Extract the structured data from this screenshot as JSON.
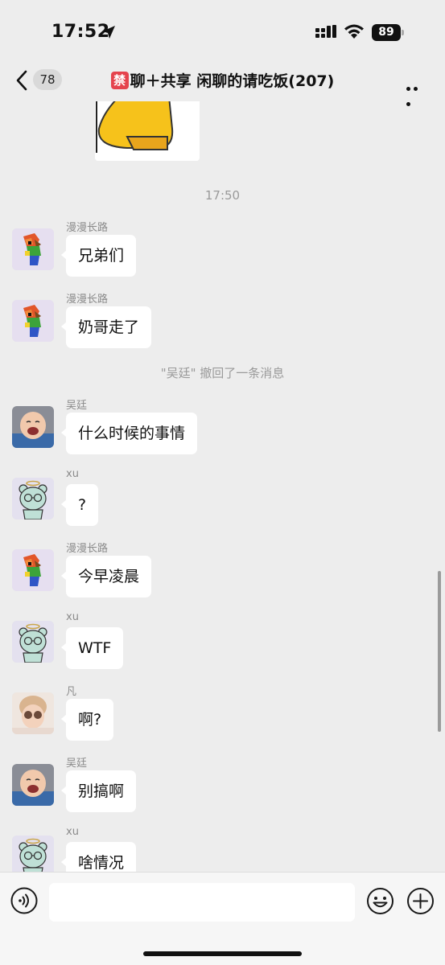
{
  "status_bar": {
    "time": "17:52",
    "battery": "89"
  },
  "nav": {
    "unread_count": "78",
    "title_badge": "禁",
    "title": "聊＋共享 闲聊的请吃饭(207)"
  },
  "chat": {
    "time_divider": "17:50",
    "system_message": "\"吴廷\" 撤回了一条消息",
    "messages": [
      {
        "sender": "漫漫长路",
        "text": "兄弟们",
        "avatar": "pixel-parrot"
      },
      {
        "sender": "漫漫长路",
        "text": "奶哥走了",
        "avatar": "pixel-parrot"
      },
      {
        "sender": "吴廷",
        "text": "什么时候的事情",
        "avatar": "crying-baby-photo"
      },
      {
        "sender": "xu",
        "text": "?",
        "avatar": "bear-with-glasses"
      },
      {
        "sender": "漫漫长路",
        "text": "今早凌晨",
        "avatar": "pixel-parrot"
      },
      {
        "sender": "xu",
        "text": "WTF",
        "avatar": "bear-with-glasses"
      },
      {
        "sender": "凡",
        "text": "啊?",
        "avatar": "child-photo"
      },
      {
        "sender": "吴廷",
        "text": "别搞啊",
        "avatar": "crying-baby-photo"
      },
      {
        "sender": "xu",
        "text": "啥情况",
        "avatar": "bear-with-glasses"
      }
    ]
  },
  "input_bar": {
    "placeholder": "",
    "icons": [
      "voice-icon",
      "emoji-icon",
      "plus-icon"
    ]
  },
  "colors": {
    "background": "#ededed",
    "bubble": "#ffffff",
    "badge_red": "#e5434d"
  }
}
